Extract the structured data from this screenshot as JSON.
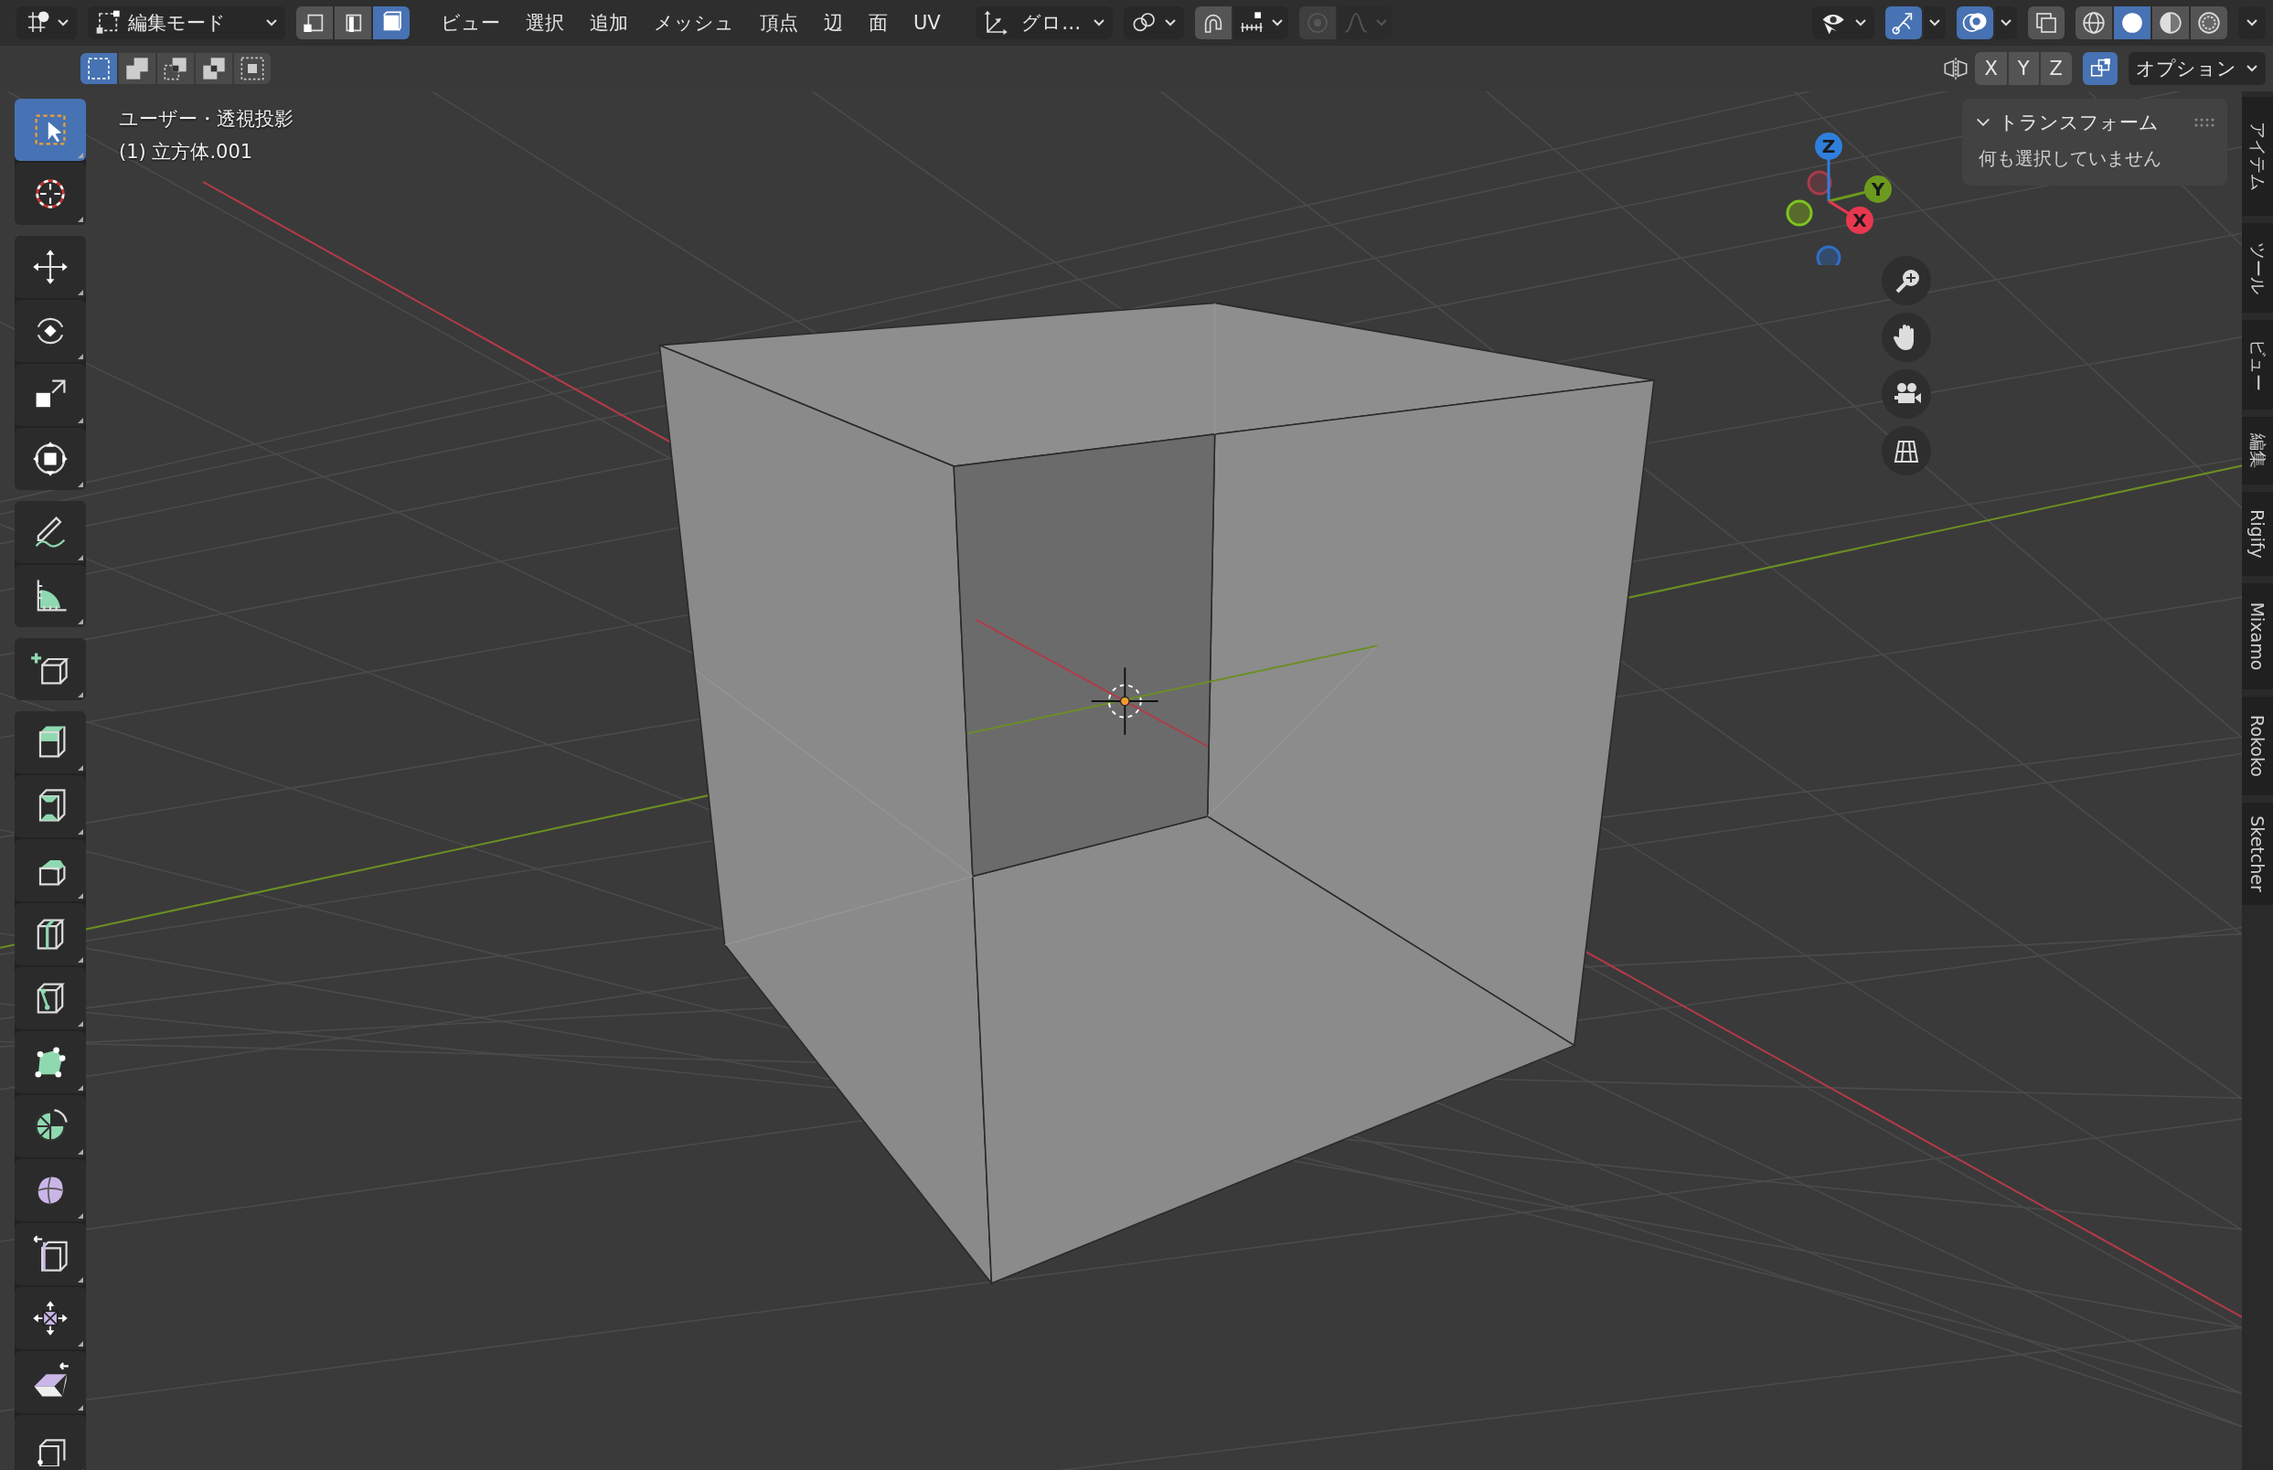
{
  "header": {
    "mode": {
      "label": "編集モード"
    },
    "select_modes": [
      {
        "kind": "vertex",
        "selected": false
      },
      {
        "kind": "edge",
        "selected": false
      },
      {
        "kind": "face",
        "selected": true
      }
    ],
    "menus": [
      "ビュー",
      "選択",
      "追加",
      "メッシュ",
      "頂点",
      "辺",
      "面",
      "UV"
    ],
    "orientation": {
      "label": "グロ…"
    },
    "snap": {
      "on": false
    },
    "proportional": {
      "on": false
    },
    "viewport_toggles": [
      {
        "kind": "gizmo",
        "on": true
      },
      {
        "kind": "overlay",
        "on": true
      },
      {
        "kind": "xray",
        "on": false
      }
    ],
    "shading": [
      {
        "kind": "wireframe",
        "selected": false
      },
      {
        "kind": "solid",
        "selected": true
      },
      {
        "kind": "material",
        "selected": false
      },
      {
        "kind": "rendered",
        "selected": false
      }
    ]
  },
  "tool_settings": {
    "selection_modes": [
      {
        "kind": "set",
        "selected": true
      },
      {
        "kind": "extend",
        "selected": false
      },
      {
        "kind": "subtract",
        "selected": false
      },
      {
        "kind": "invert",
        "selected": false
      },
      {
        "kind": "intersect",
        "selected": false
      }
    ],
    "mirror_axes": [
      {
        "label": "X",
        "on": false
      },
      {
        "label": "Y",
        "on": false
      },
      {
        "label": "Z",
        "on": false
      }
    ],
    "auto_merge": {
      "on": true
    },
    "options": {
      "label": "オプション"
    }
  },
  "viewport": {
    "view_name": "ユーザー・透視投影",
    "object_label": "(1) 立方体.001",
    "gizmo_axes": [
      {
        "label": "Z"
      },
      {
        "label": "Y"
      },
      {
        "label": "X"
      }
    ]
  },
  "toolbar": {
    "groups": [
      {
        "tools": [
          {
            "kind": "select",
            "selected": true
          },
          {
            "kind": "cursor",
            "selected": false
          }
        ]
      },
      {
        "tools": [
          {
            "kind": "move",
            "selected": false
          },
          {
            "kind": "rotate",
            "selected": false
          },
          {
            "kind": "scale",
            "selected": false
          },
          {
            "kind": "transform",
            "selected": false
          }
        ]
      },
      {
        "tools": [
          {
            "kind": "annotate",
            "selected": false
          },
          {
            "kind": "measure",
            "selected": false
          }
        ]
      },
      {
        "tools": [
          {
            "kind": "addcube",
            "selected": false
          }
        ]
      },
      {
        "tools": [
          {
            "kind": "extrude",
            "selected": false
          },
          {
            "kind": "inset",
            "selected": false
          },
          {
            "kind": "bevel",
            "selected": false
          },
          {
            "kind": "loopcut",
            "selected": false
          },
          {
            "kind": "knife",
            "selected": false
          },
          {
            "kind": "polybuild",
            "selected": false
          },
          {
            "kind": "spin",
            "selected": false
          },
          {
            "kind": "smooth",
            "selected": false
          },
          {
            "kind": "slide",
            "selected": false
          },
          {
            "kind": "shrink",
            "selected": false
          },
          {
            "kind": "shear",
            "selected": false
          },
          {
            "kind": "rip",
            "selected": false
          }
        ]
      }
    ]
  },
  "sidebar": {
    "panel": {
      "title": "トランスフォーム",
      "expanded": true,
      "message": "何も選択していません"
    },
    "tabs": [
      "アイテム",
      "ツール",
      "ビュー",
      "編集",
      "Rigify",
      "Mixamo",
      "Rokoko",
      "Sketcher"
    ]
  }
}
